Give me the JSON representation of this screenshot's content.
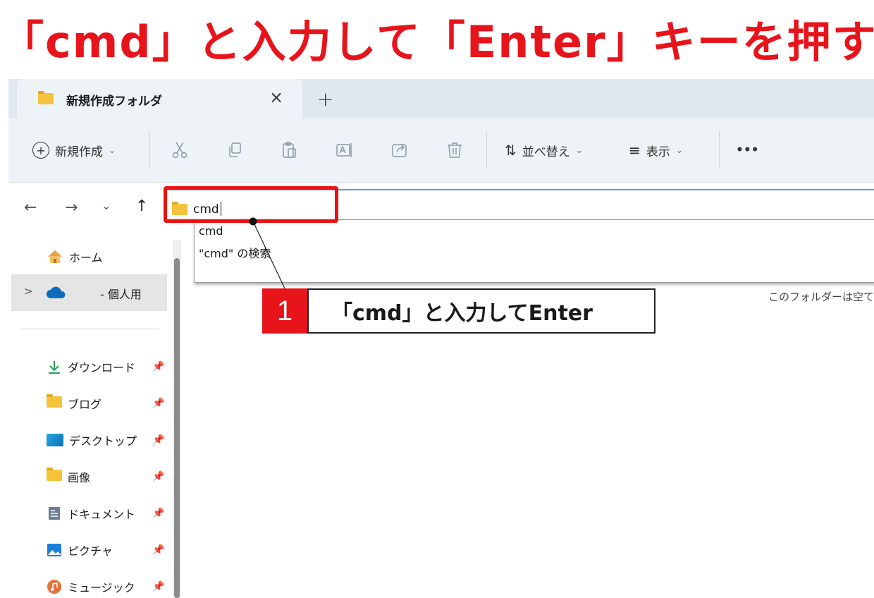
{
  "headline": "「cmd」と入力して「Enter」キーを押す",
  "tab": {
    "title": "新規作成フォルダ",
    "close": "×",
    "add": "+"
  },
  "toolbar": {
    "new_label": "新規作成",
    "sort_label": "並べ替え",
    "view_label": "表示",
    "more": "•••",
    "caret": "⌄"
  },
  "nav": {
    "back": "←",
    "forward": "→",
    "recent": "⌄",
    "up": "↑"
  },
  "address": {
    "value": "cmd"
  },
  "suggestions": [
    "cmd",
    "\"cmd\" の検索"
  ],
  "callout": {
    "number": "1",
    "text": "「cmd」と入力してEnter"
  },
  "empty_note": "このフォルダーは空て",
  "sidebar": {
    "home": "ホーム",
    "onedrive": "- 個人用",
    "expand": ">",
    "items": [
      {
        "label": "ダウンロード",
        "icon": "download-icon"
      },
      {
        "label": "ブログ",
        "icon": "folder-icon"
      },
      {
        "label": "デスクトップ",
        "icon": "desktop-icon"
      },
      {
        "label": "画像",
        "icon": "folder-icon"
      },
      {
        "label": "ドキュメント",
        "icon": "document-icon"
      },
      {
        "label": "ピクチャ",
        "icon": "picture-icon"
      },
      {
        "label": "ミュージック",
        "icon": "music-icon"
      }
    ]
  },
  "colors": {
    "accent_red": "#e8141b",
    "highlight_red": "#ee1111",
    "tab_bar": "#dfe7f0",
    "toolbar": "#eef3f8"
  }
}
